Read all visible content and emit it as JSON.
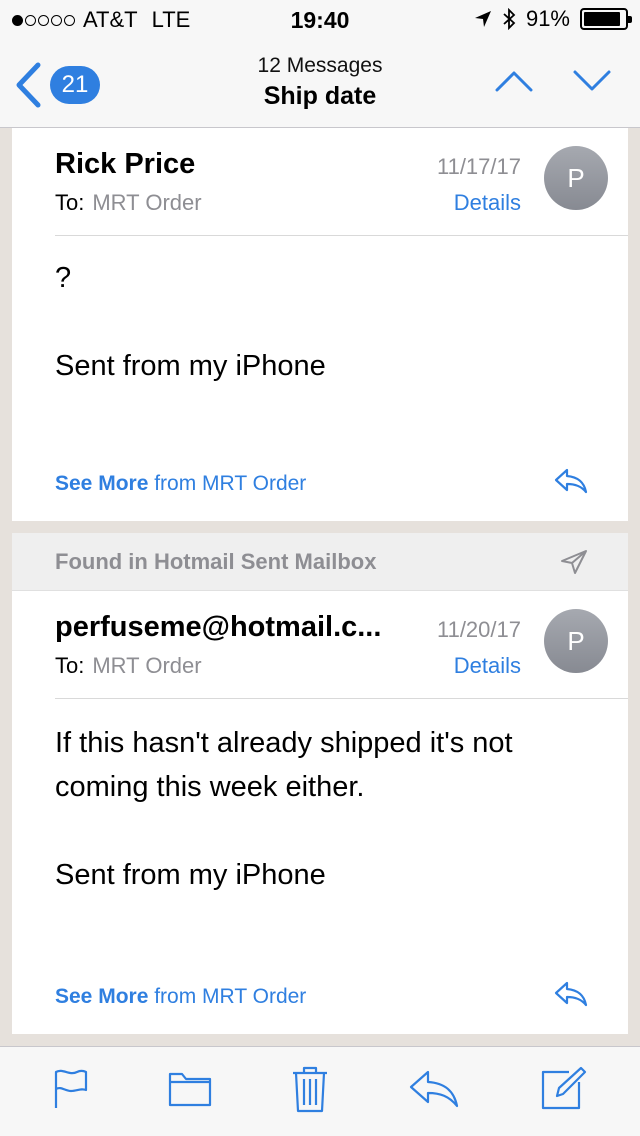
{
  "status_bar": {
    "carrier": "AT&T",
    "network": "LTE",
    "time": "19:40",
    "battery": "91%",
    "battery_level": 0.91,
    "signal_dots_filled": 1
  },
  "nav": {
    "back_count": "21",
    "subtitle": "12 Messages",
    "title": "Ship date"
  },
  "messages": [
    {
      "sender": "Rick Price",
      "to_label": "To:",
      "recipient": "MRT Order",
      "date": "11/17/17",
      "details_label": "Details",
      "avatar_initial": "P",
      "body": [
        "?",
        "Sent from my iPhone"
      ],
      "see_more_label": "See More",
      "see_more_from": "from MRT Order"
    },
    {
      "banner": "Found in Hotmail Sent Mailbox",
      "sender": "perfuseme@hotmail.c...",
      "to_label": "To:",
      "recipient": "MRT Order",
      "date": "11/20/17",
      "details_label": "Details",
      "avatar_initial": "P",
      "body": [
        "If this hasn't already shipped it's not coming this week either.",
        "Sent from my iPhone"
      ],
      "see_more_label": "See More",
      "see_more_from": "from MRT Order"
    }
  ],
  "icons": {
    "back": "chevron-left-icon",
    "up": "chevron-up-icon",
    "down": "chevron-down-icon",
    "reply": "reply-icon",
    "sent": "paper-plane-icon",
    "flag": "flag-icon",
    "folder": "folder-icon",
    "trash": "trash-icon",
    "compose": "compose-icon"
  },
  "colors": {
    "accent": "#2f7fe0",
    "muted": "#8e8e93"
  }
}
